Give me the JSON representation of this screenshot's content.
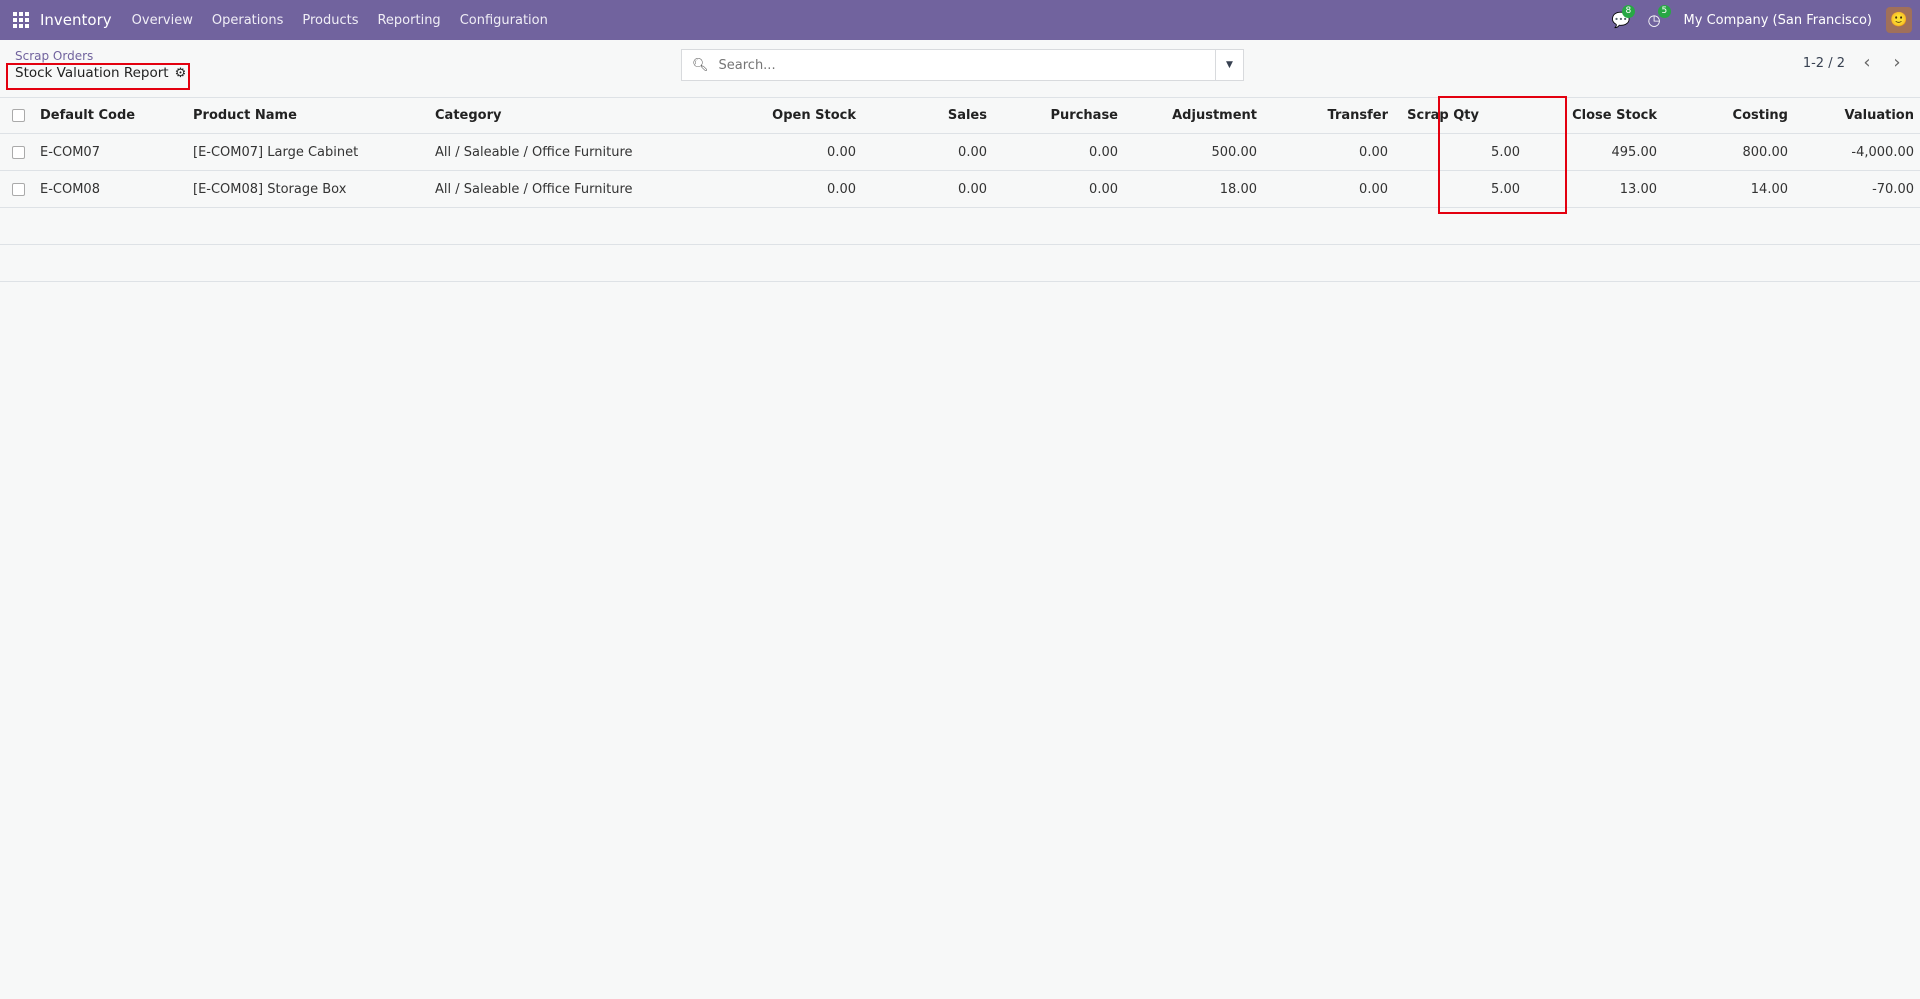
{
  "nav": {
    "app": "Inventory",
    "menus": [
      "Overview",
      "Operations",
      "Products",
      "Reporting",
      "Configuration"
    ],
    "messages_count": "8",
    "activities_count": "5",
    "company": "My Company (San Francisco)"
  },
  "breadcrumb": {
    "parent": "Scrap Orders",
    "title": "Stock Valuation Report"
  },
  "search": {
    "placeholder": "Search..."
  },
  "pager": {
    "text": "1-2 / 2"
  },
  "table": {
    "headers": [
      "Default Code",
      "Product Name",
      "Category",
      "Open Stock",
      "Sales",
      "Purchase",
      "Adjustment",
      "Transfer",
      "Scrap Qty",
      "Close Stock",
      "Costing",
      "Valuation"
    ],
    "rows": [
      [
        "E-COM07",
        "[E-COM07] Large Cabinet",
        "All / Saleable / Office Furniture",
        "0.00",
        "0.00",
        "0.00",
        "500.00",
        "0.00",
        "5.00",
        "495.00",
        "800.00",
        "-4,000.00"
      ],
      [
        "E-COM08",
        "[E-COM08] Storage Box",
        "All / Saleable / Office Furniture",
        "0.00",
        "0.00",
        "0.00",
        "18.00",
        "0.00",
        "5.00",
        "13.00",
        "14.00",
        "-70.00"
      ]
    ]
  }
}
